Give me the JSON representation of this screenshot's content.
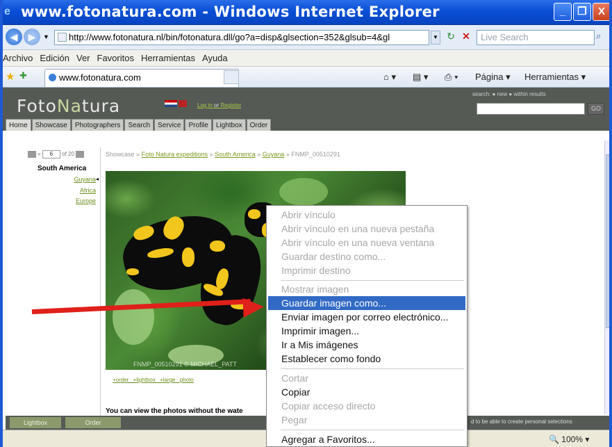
{
  "window": {
    "title": "www.fotonatura.com - Windows Internet Explorer",
    "minimize_glyph": "_",
    "maximize_glyph": "❐",
    "close_glyph": "X"
  },
  "address": {
    "url": "http://www.fotonatura.nl/bin/fotonatura.dll/go?a=disp&glsection=352&glsub=4&gl",
    "search_placeholder": "Live Search"
  },
  "menubar": [
    "Archivo",
    "Edición",
    "Ver",
    "Favoritos",
    "Herramientas",
    "Ayuda"
  ],
  "tab": {
    "title": "www.fotonatura.com"
  },
  "commands": {
    "page": "Página ▾",
    "tools": "Herramientas ▾"
  },
  "site": {
    "logo_a": "Foto",
    "logo_b": "Na",
    "logo_c": "tura",
    "login": "Log in",
    "or": "or",
    "register": "Register",
    "search_label": "search:  ● new  ● within results",
    "search_go": "GO",
    "nav": [
      "Home",
      "Showcase",
      "Photographers",
      "Search",
      "Service",
      "Profile",
      "Lightbox",
      "Order"
    ],
    "pager": {
      "current": "6",
      "total": "of 20"
    },
    "breadcrumb": {
      "root": "Showcase",
      "items": [
        "Foto Natura expeditions",
        "South America",
        "Guyana"
      ],
      "last": "FNMP_00510291",
      "sep": "»"
    },
    "regions": {
      "heading": "South America",
      "items": [
        "Guyana",
        "Africa",
        "Europe"
      ]
    },
    "watermark": "FNMP_00510291 © MICHAEL_PATT",
    "photo_links": "+order +lightbox +large photo",
    "bottom_text": "You can view the photos without the wate",
    "bottom_bar": {
      "lightbox": "Lightbox",
      "order": "Order",
      "right_text": "d to be able to create personal selections"
    }
  },
  "status": {
    "zoom": "100%"
  },
  "context_menu": {
    "items": [
      {
        "label": "Abrir vínculo",
        "state": "disabled"
      },
      {
        "label": "Abrir vínculo en una nueva pestaña",
        "state": "disabled"
      },
      {
        "label": "Abrir vínculo en una nueva ventana",
        "state": "disabled"
      },
      {
        "label": "Guardar destino como...",
        "state": "disabled"
      },
      {
        "label": "Imprimir destino",
        "state": "disabled"
      },
      {
        "label": "Mostrar imagen",
        "state": "disabled"
      },
      {
        "label": "Guardar imagen como...",
        "state": "selected"
      },
      {
        "label": "Enviar imagen por correo electrónico...",
        "state": "enabled"
      },
      {
        "label": "Imprimir imagen...",
        "state": "enabled"
      },
      {
        "label": "Ir a Mis imágenes",
        "state": "enabled"
      },
      {
        "label": "Establecer como fondo",
        "state": "enabled"
      },
      {
        "label": "Cortar",
        "state": "disabled"
      },
      {
        "label": "Copiar",
        "state": "enabled"
      },
      {
        "label": "Copiar acceso directo",
        "state": "disabled"
      },
      {
        "label": "Pegar",
        "state": "disabled"
      },
      {
        "label": "Agregar a Favoritos...",
        "state": "enabled"
      }
    ]
  },
  "colors": {
    "titlebar": "#0a4fd6",
    "selection": "#316ac5",
    "arrow": "#e0201a",
    "site_link": "#7a9a1e"
  }
}
